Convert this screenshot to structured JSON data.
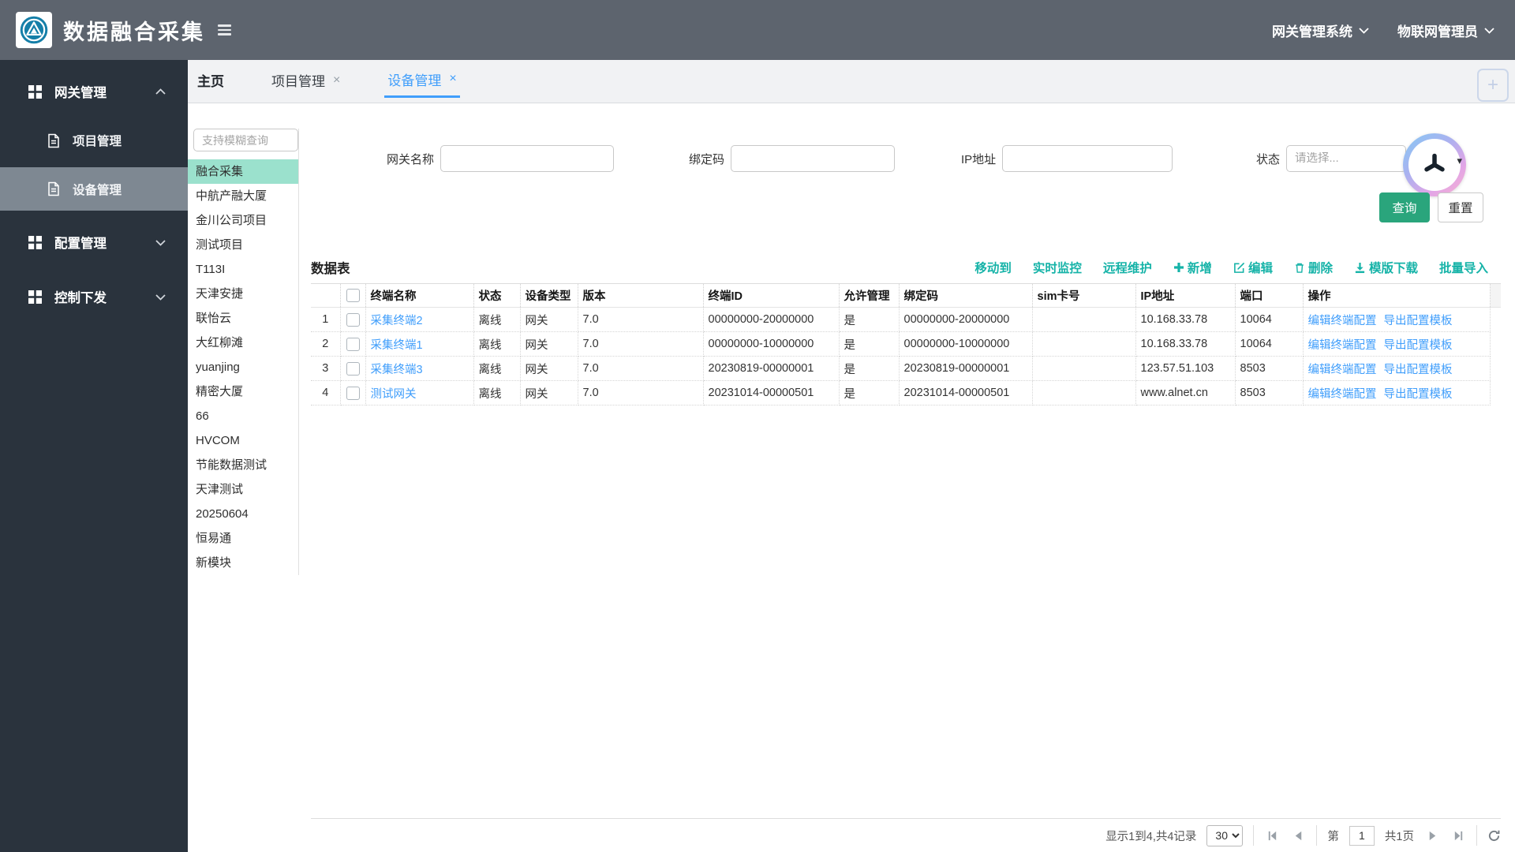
{
  "header": {
    "app_title": "数据融合采集",
    "system_dropdown": "网关管理系统",
    "user_dropdown": "物联网管理员"
  },
  "sidebar": {
    "items": [
      {
        "label": "网关管理",
        "expanded": true
      },
      {
        "label": "项目管理",
        "selected": false
      },
      {
        "label": "设备管理",
        "selected": true
      },
      {
        "label": "配置管理",
        "expanded": false
      },
      {
        "label": "控制下发",
        "expanded": false
      }
    ]
  },
  "tabs": [
    {
      "label": "主页",
      "closable": false,
      "active": false
    },
    {
      "label": "项目管理",
      "closable": true,
      "active": false
    },
    {
      "label": "设备管理",
      "closable": true,
      "active": true
    }
  ],
  "project_panel": {
    "search_placeholder": "支持模糊查询",
    "selected": "融合采集",
    "items": [
      "融合采集",
      "中航产融大厦",
      "金川公司项目",
      "测试项目",
      "T113I",
      "天津安捷",
      "联怡云",
      "大红柳滩",
      "yuanjing",
      "精密大厦",
      "66",
      "HVCOM",
      "节能数据测试",
      "天津测试",
      "20250604",
      "恒易通",
      "新模块"
    ]
  },
  "filters": {
    "fields": [
      {
        "label": "网关名称",
        "value": ""
      },
      {
        "label": "绑定码",
        "value": ""
      },
      {
        "label": "IP地址",
        "value": ""
      },
      {
        "label": "状态",
        "placeholder": "请选择..."
      }
    ],
    "search_button": "查询",
    "reset_button": "重置"
  },
  "grid": {
    "title": "数据表",
    "toolbar": [
      {
        "label": "移动到",
        "icon": ""
      },
      {
        "label": "实时监控",
        "icon": ""
      },
      {
        "label": "远程维护",
        "icon": ""
      },
      {
        "label": "新增",
        "icon": "plus"
      },
      {
        "label": "编辑",
        "icon": "edit"
      },
      {
        "label": "删除",
        "icon": "trash"
      },
      {
        "label": "模版下载",
        "icon": "download"
      },
      {
        "label": "批量导入",
        "icon": ""
      }
    ],
    "columns": [
      {
        "key": "num",
        "label": ""
      },
      {
        "key": "check",
        "label": ""
      },
      {
        "key": "name",
        "label": "终端名称"
      },
      {
        "key": "status",
        "label": "状态"
      },
      {
        "key": "type",
        "label": "设备类型"
      },
      {
        "key": "version",
        "label": "版本"
      },
      {
        "key": "terminal_id",
        "label": "终端ID"
      },
      {
        "key": "allow",
        "label": "允许管理"
      },
      {
        "key": "bind_code",
        "label": "绑定码"
      },
      {
        "key": "sim",
        "label": "sim卡号"
      },
      {
        "key": "ip",
        "label": "IP地址"
      },
      {
        "key": "port",
        "label": "端口"
      },
      {
        "key": "actions",
        "label": "操作"
      }
    ],
    "rows": [
      {
        "num": "1",
        "name": "采集终端2",
        "status": "离线",
        "type": "网关",
        "version": "7.0",
        "terminal_id": "00000000-20000000",
        "allow": "是",
        "bind_code": "00000000-20000000",
        "sim": "",
        "ip": "10.168.33.78",
        "port": "10064",
        "actions": [
          "编辑终端配置",
          "导出配置模板"
        ]
      },
      {
        "num": "2",
        "name": "采集终端1",
        "status": "离线",
        "type": "网关",
        "version": "7.0",
        "terminal_id": "00000000-10000000",
        "allow": "是",
        "bind_code": "00000000-10000000",
        "sim": "",
        "ip": "10.168.33.78",
        "port": "10064",
        "actions": [
          "编辑终端配置",
          "导出配置模板"
        ]
      },
      {
        "num": "3",
        "name": "采集终端3",
        "status": "离线",
        "type": "网关",
        "version": "7.0",
        "terminal_id": "20230819-00000001",
        "allow": "是",
        "bind_code": "20230819-00000001",
        "sim": "",
        "ip": "123.57.51.103",
        "port": "8503",
        "actions": [
          "编辑终端配置",
          "导出配置模板"
        ]
      },
      {
        "num": "4",
        "name": "测试网关",
        "status": "离线",
        "type": "网关",
        "version": "7.0",
        "terminal_id": "20231014-00000501",
        "allow": "是",
        "bind_code": "20231014-00000501",
        "sim": "",
        "ip": "www.alnet.cn",
        "port": "8503",
        "actions": [
          "编辑终端配置",
          "导出配置模板"
        ]
      }
    ]
  },
  "pagination": {
    "summary": "显示1到4,共4记录",
    "page_size": "30",
    "page_prefix": "第",
    "page_value": "1",
    "page_total": "共1页"
  },
  "colors": {
    "header_bg": "#5d646e",
    "sidebar_bg": "#2a333d",
    "sidebar_selected": "#7e8892",
    "accent_teal": "#16b3a8",
    "mint_highlight": "#9be1cd",
    "link_blue": "#409efb",
    "query_green": "#2aa57c"
  }
}
